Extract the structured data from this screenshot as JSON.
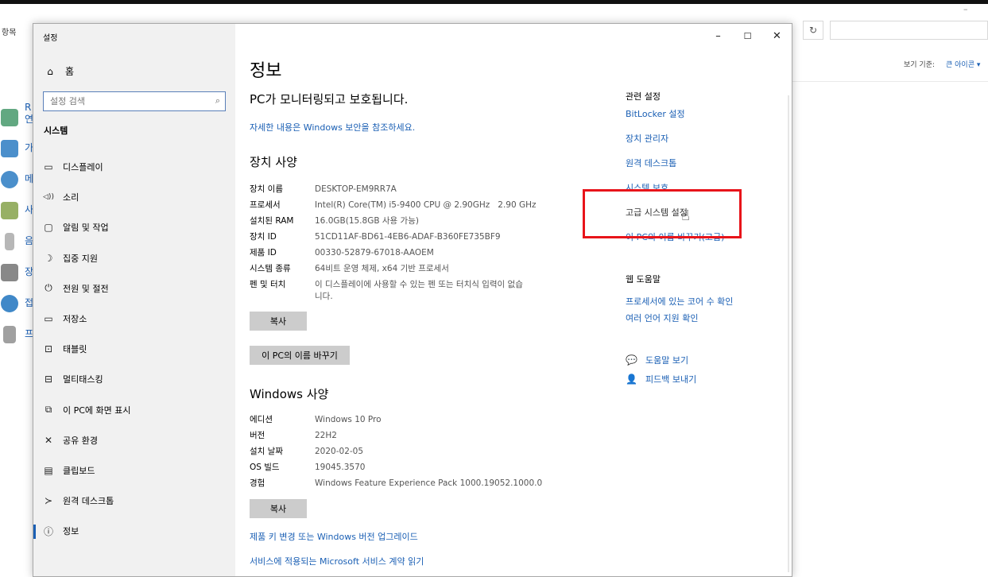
{
  "background": {
    "title_fragment": "항목",
    "minimize_glyph": "–",
    "refresh_glyph": "↻",
    "view_label": "보기 기준:",
    "view_value": "큰 아이콘 ▾",
    "items": [
      {
        "icon": "recycle-icon",
        "color": "#2e8b57",
        "text": "R\n연"
      },
      {
        "icon": "shield-check-icon",
        "color": "#1e73be",
        "text": "가"
      },
      {
        "icon": "globe-icon",
        "color": "#1e73be",
        "text": "메"
      },
      {
        "icon": "users-icon",
        "color": "#6b8e23",
        "text": "사"
      },
      {
        "icon": "mic-icon",
        "color": "#999999",
        "text": "음"
      },
      {
        "icon": "computer-icon",
        "color": "#555555",
        "text": "장"
      },
      {
        "icon": "access-icon",
        "color": "#1e73be",
        "text": "접"
      },
      {
        "icon": "program-icon",
        "color": "#777777",
        "text": "프"
      }
    ]
  },
  "window": {
    "title": "설정",
    "controls": {
      "minimize": "–",
      "maximize": "☐",
      "close": "✕"
    }
  },
  "sidebar": {
    "home_label": "홈",
    "home_icon": "⌂",
    "search_placeholder": "설정 검색",
    "search_icon": "⌕",
    "section_title": "시스템",
    "items": [
      {
        "label": "디스플레이",
        "icon": "▭"
      },
      {
        "label": "소리",
        "icon": "◁))"
      },
      {
        "label": "알림 및 작업",
        "icon": "▢"
      },
      {
        "label": "집중 지원",
        "icon": "☽"
      },
      {
        "label": "전원 및 절전",
        "icon": "⏻"
      },
      {
        "label": "저장소",
        "icon": "▭"
      },
      {
        "label": "태블릿",
        "icon": "⊡"
      },
      {
        "label": "멀티태스킹",
        "icon": "⊟"
      },
      {
        "label": "이 PC에 화면 표시",
        "icon": "⧉"
      },
      {
        "label": "공유 환경",
        "icon": "✕"
      },
      {
        "label": "클립보드",
        "icon": "▤"
      },
      {
        "label": "원격 데스크톱",
        "icon": "≻"
      },
      {
        "label": "정보",
        "icon": "ⓘ",
        "active": true
      }
    ]
  },
  "main": {
    "page_title": "정보",
    "protection_heading": "PC가 모니터링되고 보호됩니다.",
    "protection_link": "자세한 내용은 Windows 보안을 참조하세요.",
    "device_specs_heading": "장치 사양",
    "device_specs": [
      {
        "label": "장치 이름",
        "value": "DESKTOP-EM9RR7A"
      },
      {
        "label": "프로세서",
        "value": "Intel(R) Core(TM) i5-9400 CPU @ 2.90GHz   2.90 GHz"
      },
      {
        "label": "설치된 RAM",
        "value": "16.0GB(15.8GB 사용 가능)"
      },
      {
        "label": "장치 ID",
        "value": "51CD11AF-BD61-4EB6-ADAF-B360FE735BF9"
      },
      {
        "label": "제품 ID",
        "value": "00330-52879-67018-AAOEM"
      },
      {
        "label": "시스템 종류",
        "value": "64비트 운영 체제, x64 기반 프로세서"
      },
      {
        "label": "펜 및 터치",
        "value": "이 디스플레이에 사용할 수 있는 펜 또는 터치식 입력이 없습니다."
      }
    ],
    "copy_button_1": "복사",
    "rename_button": "이 PC의 이름 바꾸기",
    "windows_specs_heading": "Windows 사양",
    "windows_specs": [
      {
        "label": "에디션",
        "value": "Windows 10 Pro"
      },
      {
        "label": "버전",
        "value": "22H2"
      },
      {
        "label": "설치 날짜",
        "value": "2020-02-05"
      },
      {
        "label": "OS 빌드",
        "value": "19045.3570"
      },
      {
        "label": "경험",
        "value": "Windows Feature Experience Pack 1000.19052.1000.0"
      }
    ],
    "copy_button_2": "복사",
    "product_key_link": "제품 키 변경 또는 Windows 버전 업그레이드",
    "service_agreement_link": "서비스에 적용되는 Microsoft 서비스 계약 읽기"
  },
  "related": {
    "heading": "관련 설정",
    "links": [
      "BitLocker 설정",
      "장치 관리자",
      "원격 데스크톱",
      "시스템 보호",
      "고급 시스템 설정",
      "이 PC의 이름 바꾸기(고급)"
    ],
    "web_help_heading": "웹 도움말",
    "web_help_links": [
      "프로세서에 있는 코어 수 확인",
      "여러 언어 지원 확인"
    ],
    "help_items": [
      {
        "label": "도움말 보기",
        "icon": "💬"
      },
      {
        "label": "피드백 보내기",
        "icon": "👤"
      }
    ]
  },
  "highlight_color": "#e8141a",
  "accent_color": "#1a5fb4"
}
